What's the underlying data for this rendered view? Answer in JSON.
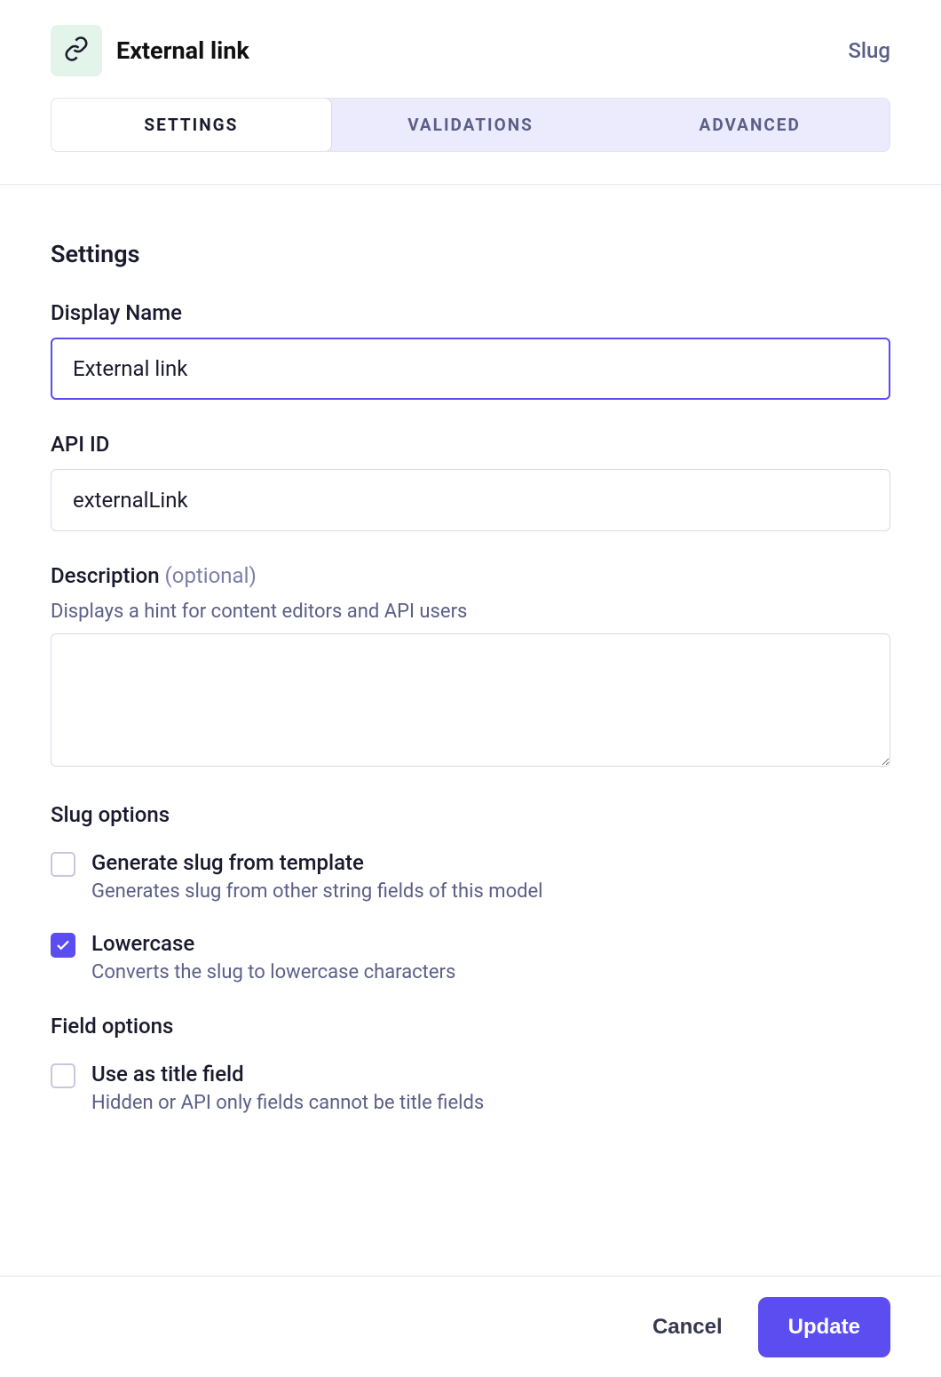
{
  "header": {
    "title": "External link",
    "type": "Slug",
    "icon": "link-icon"
  },
  "tabs": {
    "settings": "SETTINGS",
    "validations": "VALIDATIONS",
    "advanced": "ADVANCED",
    "active": "settings"
  },
  "settings": {
    "section_title": "Settings",
    "display_name": {
      "label": "Display Name",
      "value": "External link"
    },
    "api_id": {
      "label": "API ID",
      "value": "externalLink"
    },
    "description": {
      "label": "Description",
      "optional": "(optional)",
      "hint": "Displays a hint for content editors and API users",
      "value": ""
    },
    "slug_options": {
      "title": "Slug options",
      "generate": {
        "label": "Generate slug from template",
        "desc": "Generates slug from other string fields of this model",
        "checked": false
      },
      "lowercase": {
        "label": "Lowercase",
        "desc": "Converts the slug to lowercase characters",
        "checked": true
      }
    },
    "field_options": {
      "title": "Field options",
      "title_field": {
        "label": "Use as title field",
        "desc": "Hidden or API only fields cannot be title fields",
        "checked": false
      }
    }
  },
  "footer": {
    "cancel": "Cancel",
    "update": "Update"
  }
}
